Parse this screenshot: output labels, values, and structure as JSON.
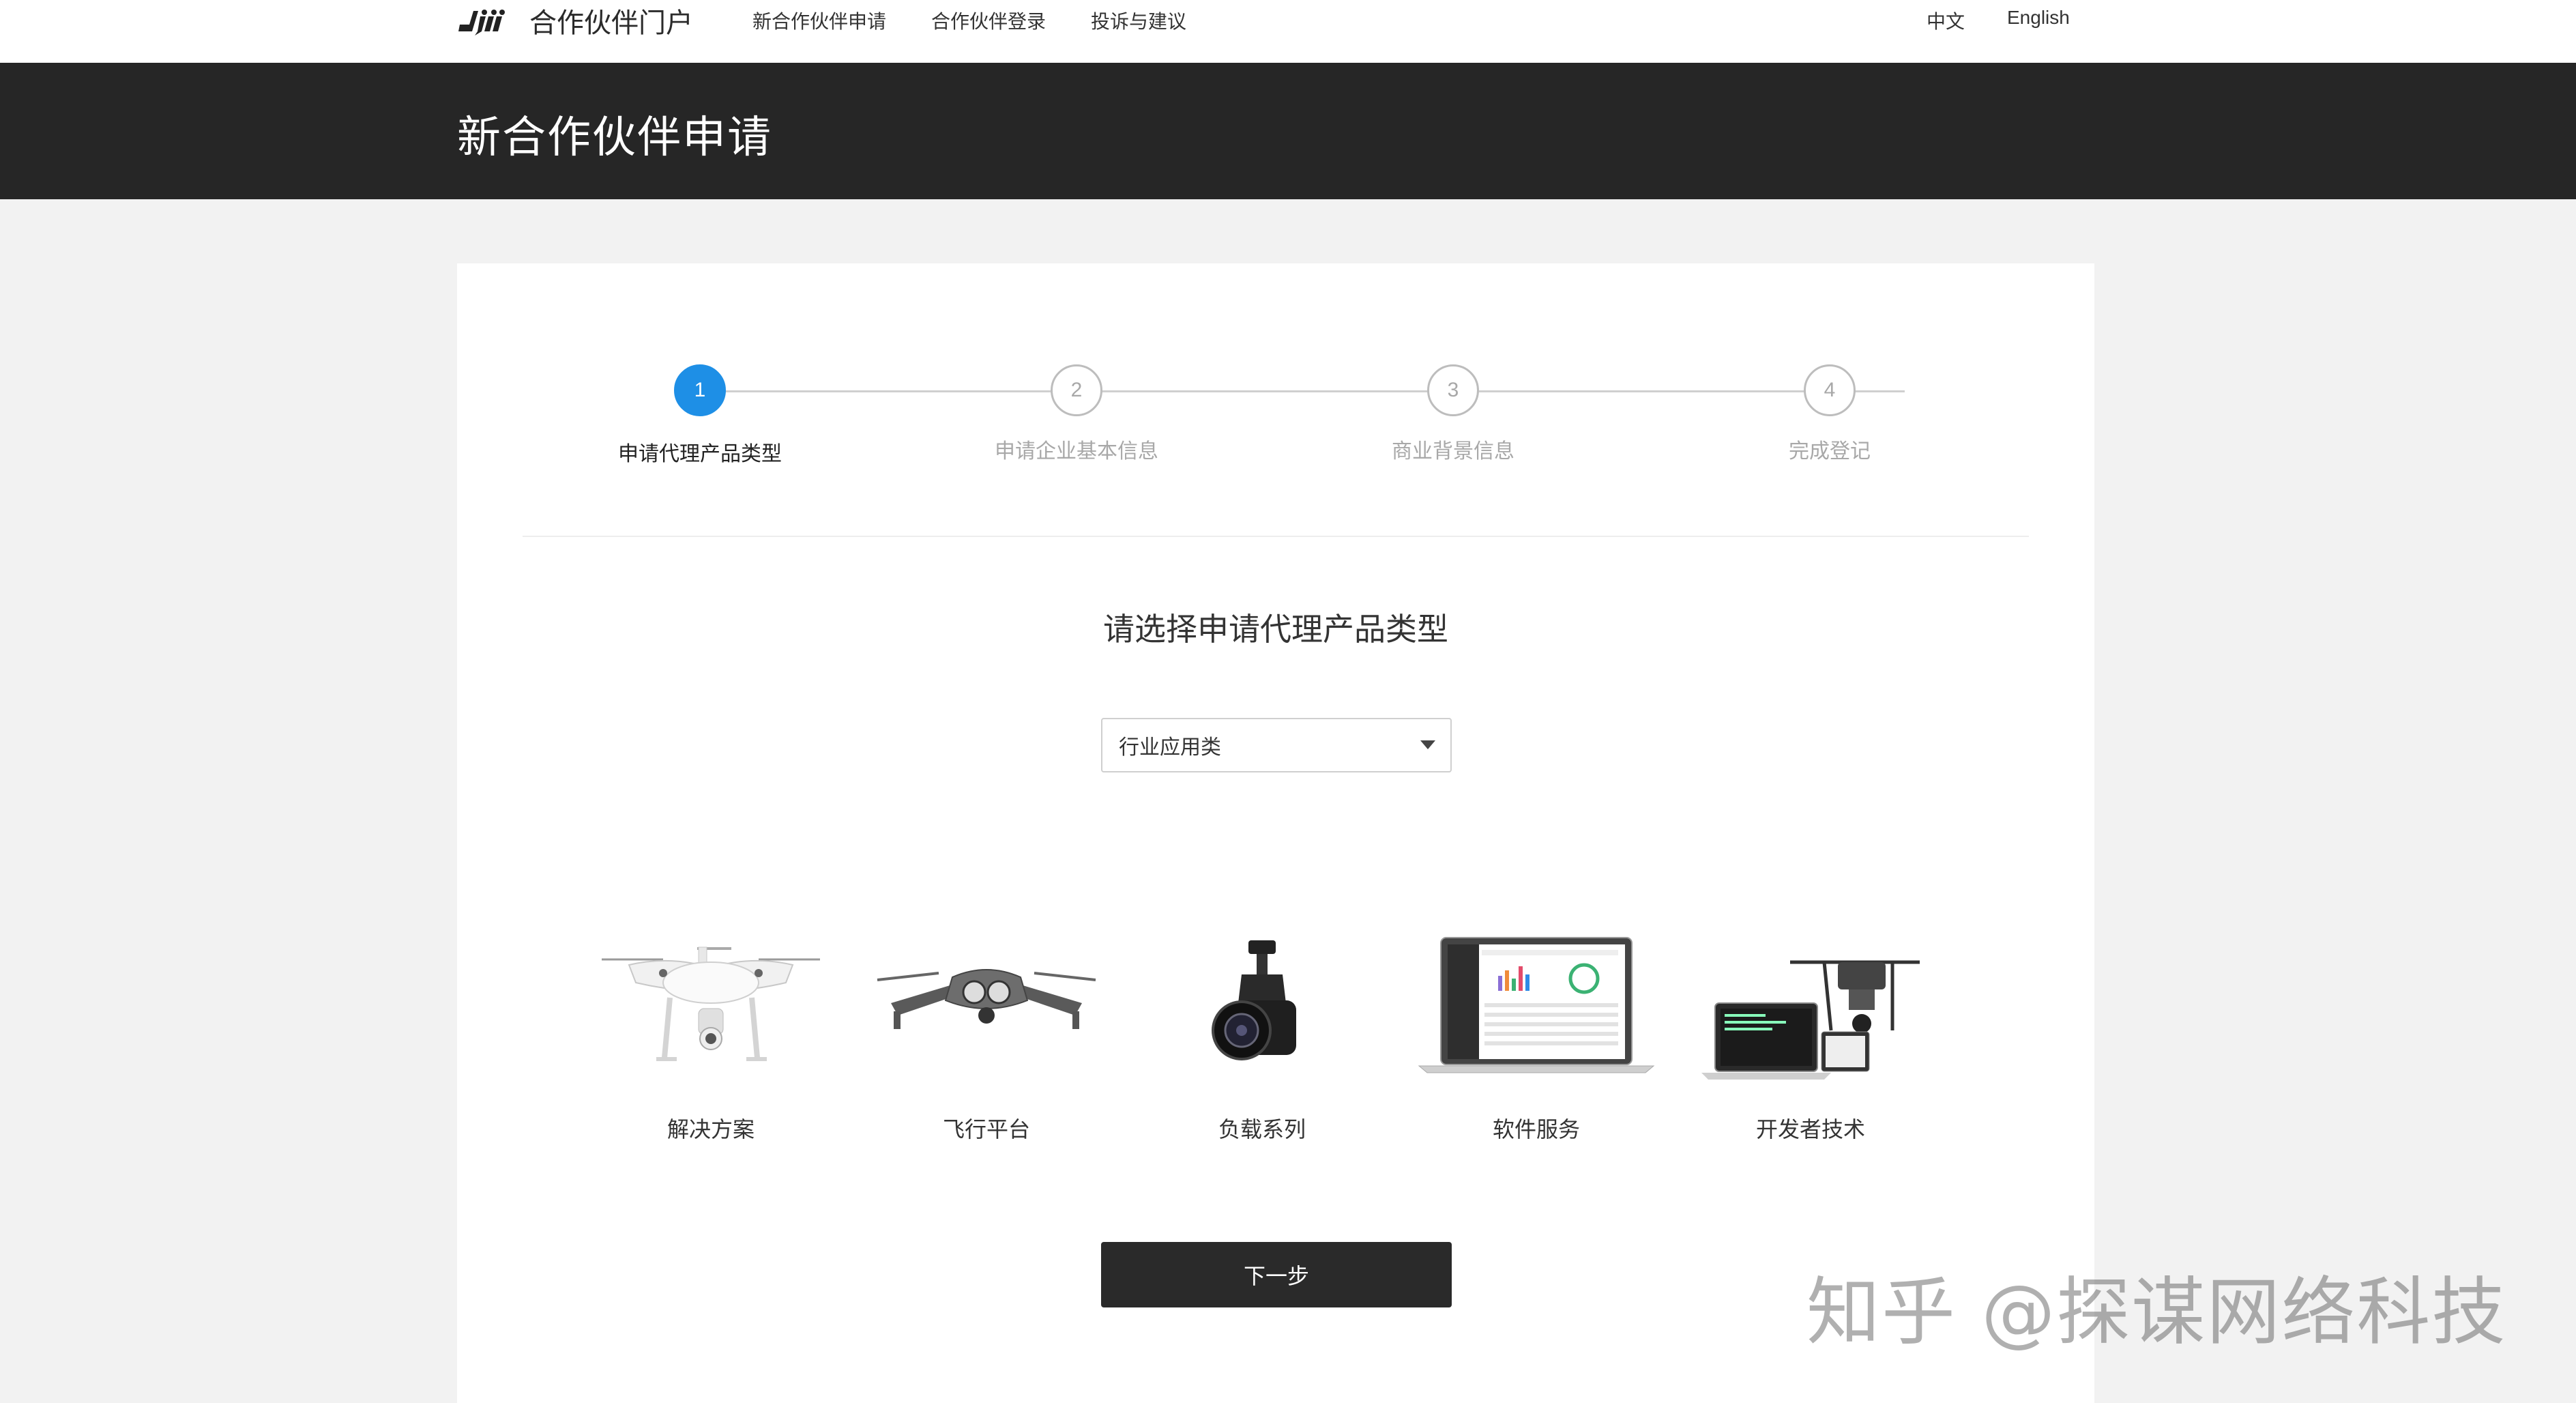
{
  "brand": {
    "logo_text": "合作伙伴门户"
  },
  "nav": {
    "items": [
      "新合作伙伴申请",
      "合作伙伴登录",
      "投诉与建议"
    ]
  },
  "lang": {
    "zh": "中文",
    "en": "English"
  },
  "banner": {
    "title": "新合作伙伴申请"
  },
  "steps": [
    {
      "number": "1",
      "label": "申请代理产品类型",
      "active": true
    },
    {
      "number": "2",
      "label": "申请企业基本信息",
      "active": false
    },
    {
      "number": "3",
      "label": "商业背景信息",
      "active": false
    },
    {
      "number": "4",
      "label": "完成登记",
      "active": false
    }
  ],
  "section": {
    "title": "请选择申请代理产品类型"
  },
  "select": {
    "value": "行业应用类"
  },
  "products": [
    {
      "label": "解决方案",
      "icon": "quadcopter-drone-icon"
    },
    {
      "label": "飞行平台",
      "icon": "foldable-drone-icon"
    },
    {
      "label": "负载系列",
      "icon": "gimbal-camera-icon"
    },
    {
      "label": "软件服务",
      "icon": "laptop-dashboard-icon"
    },
    {
      "label": "开发者技术",
      "icon": "developer-drone-laptop-icon"
    }
  ],
  "next_button": {
    "label": "下一步"
  },
  "watermark": {
    "text": "知乎 @探谋网络科技"
  },
  "colors": {
    "accent": "#1e8fe6",
    "banner": "#262626",
    "button": "#2a2a2a"
  }
}
